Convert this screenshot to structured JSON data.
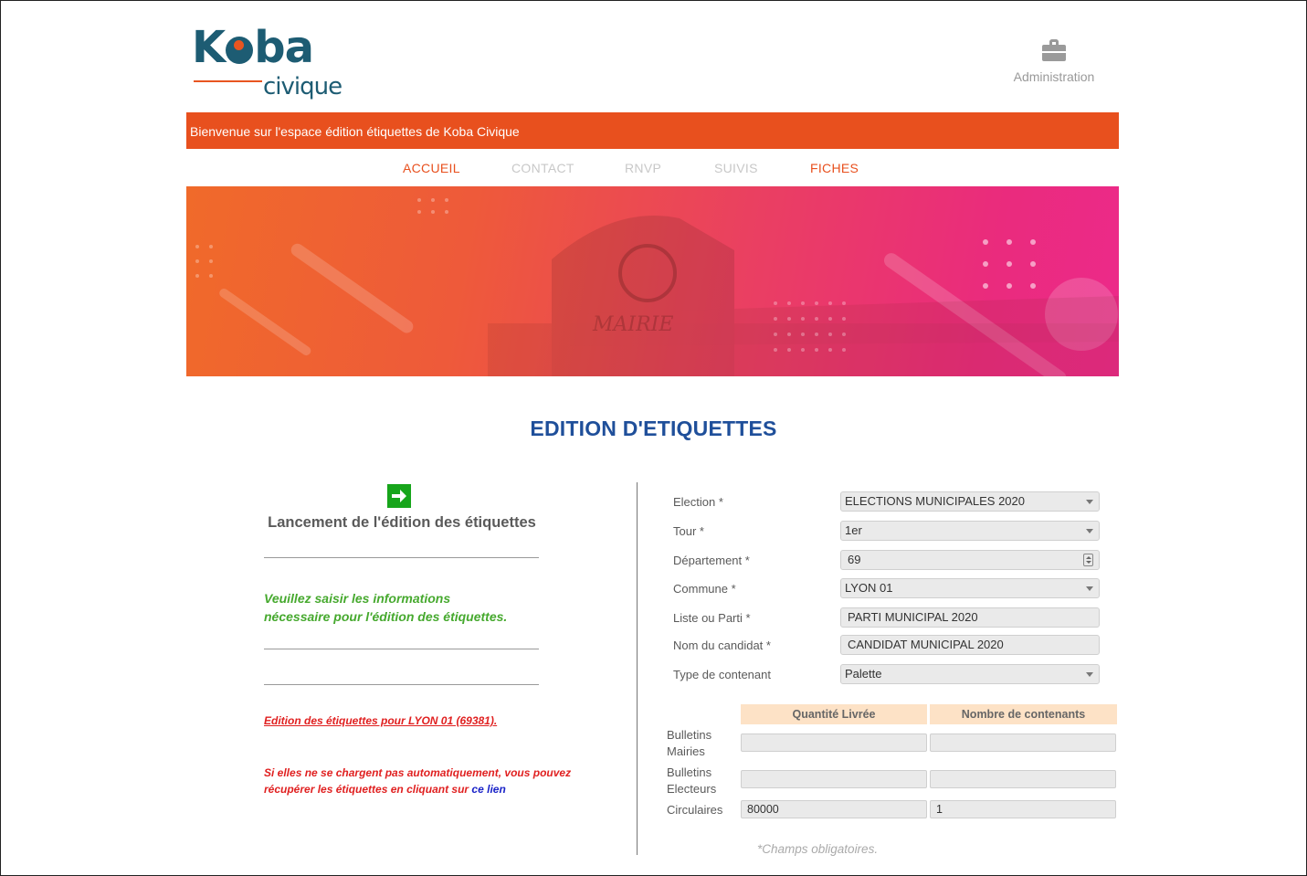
{
  "header": {
    "logo": {
      "brand": "Koba",
      "sub": "civique"
    },
    "admin": {
      "icon": "briefcase-icon",
      "label": "Administration"
    },
    "welcome": "Bienvenue sur l'espace édition étiquettes de Koba Civique"
  },
  "nav": {
    "items": [
      {
        "label": "ACCUEIL",
        "active": true
      },
      {
        "label": "CONTACT",
        "active": false
      },
      {
        "label": "RNVP",
        "active": false
      },
      {
        "label": "SUIVIS",
        "active": false
      },
      {
        "label": "FICHES",
        "active": true
      }
    ]
  },
  "banner": {
    "building_text": "MAIRIE"
  },
  "page": {
    "title": "EDITION D'ETIQUETTES"
  },
  "left": {
    "icon": "arrow-right-icon",
    "title": "Lancement de l'édition des étiquettes",
    "info_line1": "Veuillez saisir les informations",
    "info_line2": "nécessaire pour l'édition des étiquettes.",
    "edition_msg": "Edition des étiquettes pour LYON 01 (69381).",
    "note_line1": "Si elles ne se chargent pas automatiquement, vous pouvez",
    "note_line2": "récupérer les étiquettes en cliquant sur",
    "note_link": "ce lien"
  },
  "form": {
    "election": {
      "label": "Election *",
      "value": "ELECTIONS MUNICIPALES 2020"
    },
    "tour": {
      "label": "Tour *",
      "value": "1er"
    },
    "departement": {
      "label": "Département *",
      "value": "69"
    },
    "commune": {
      "label": "Commune *",
      "value": "LYON 01"
    },
    "liste": {
      "label": "Liste ou Parti *",
      "value": "PARTI MUNICIPAL 2020"
    },
    "candidat": {
      "label": "Nom du candidat *",
      "value": "CANDIDAT MUNICIPAL 2020"
    },
    "contenant": {
      "label": "Type de contenant",
      "value": "Palette"
    }
  },
  "quantities": {
    "headers": [
      "Quantité Livrée",
      "Nombre de contenants"
    ],
    "rows": [
      {
        "label_line1": "Bulletins",
        "label_line2": "Mairies",
        "qty": "",
        "count": ""
      },
      {
        "label_line1": "Bulletins",
        "label_line2": "Electeurs",
        "qty": "",
        "count": ""
      },
      {
        "label_line1": "Circulaires",
        "label_line2": "",
        "qty": "80000",
        "count": "1"
      }
    ]
  },
  "required_note": "*Champs obligatoires.",
  "colors": {
    "accent": "#e8501e",
    "title_blue": "#1f4f9a",
    "green": "#46a92e",
    "red": "#e02020",
    "header_peach": "#fde2c6"
  }
}
